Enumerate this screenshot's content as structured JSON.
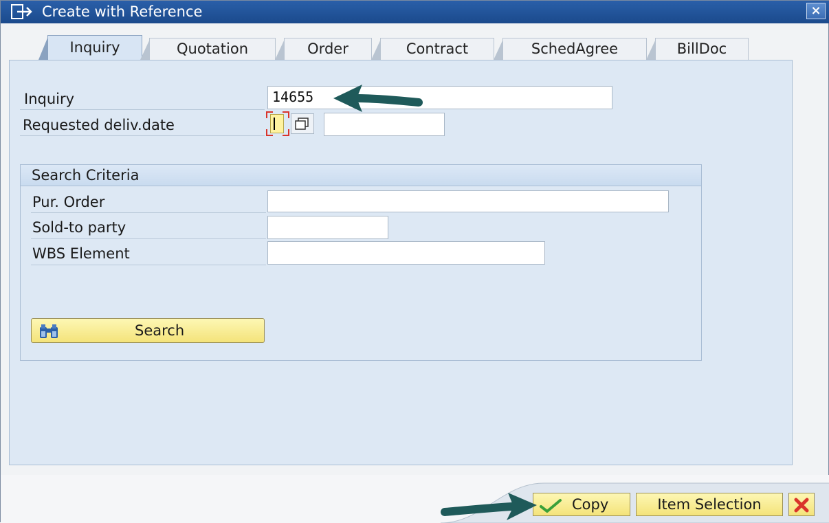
{
  "window": {
    "title": "Create with Reference",
    "close_label": "×"
  },
  "tabs": [
    {
      "label": "Inquiry",
      "active": true
    },
    {
      "label": "Quotation",
      "active": false
    },
    {
      "label": "Order",
      "active": false
    },
    {
      "label": "Contract",
      "active": false
    },
    {
      "label": "SchedAgree",
      "active": false
    },
    {
      "label": "BillDoc",
      "active": false
    }
  ],
  "form": {
    "inquiry_label": "Inquiry",
    "inquiry_value": "14655",
    "req_date_label": "Requested deliv.date",
    "req_date_value": "",
    "req_date_second_value": ""
  },
  "search_criteria": {
    "title": "Search Criteria",
    "pur_order_label": "Pur. Order",
    "pur_order_value": "",
    "sold_to_label": "Sold-to party",
    "sold_to_value": "",
    "wbs_label": "WBS Element",
    "wbs_value": "",
    "search_button": "Search"
  },
  "footer": {
    "copy_button": "Copy",
    "item_selection_button": "Item Selection"
  },
  "colors": {
    "title_bar": "#1b4a8c",
    "panel": "#dde8f4",
    "button": "#f4e37a",
    "arrow": "#1f5a5a",
    "required_marker": "#d9342b"
  },
  "icons": {
    "title": "create-with-reference-icon",
    "search": "binoculars-icon",
    "copy": "green-check-icon",
    "cancel": "red-x-icon",
    "f4": "value-help-icon"
  }
}
